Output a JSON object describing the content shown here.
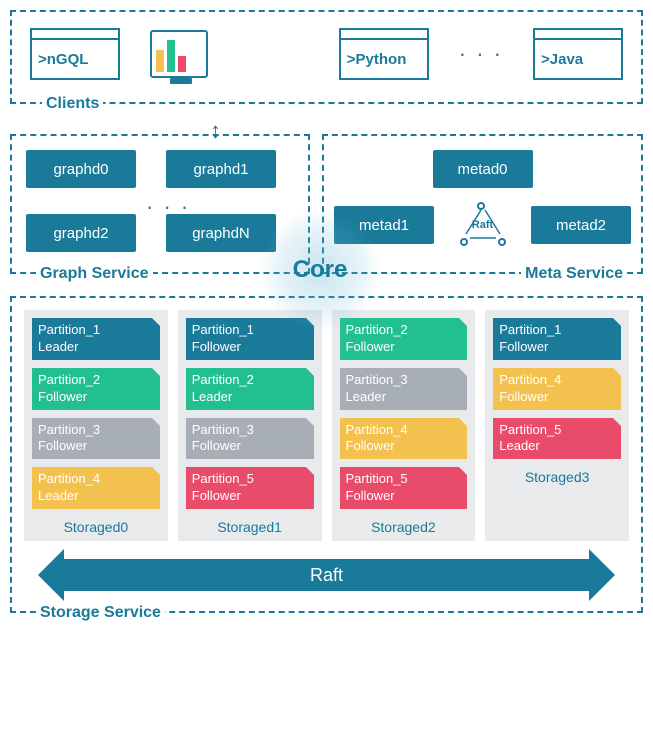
{
  "clients": {
    "label": "Clients",
    "items": [
      ">nGQL",
      ">Python",
      ">Java"
    ],
    "dots": "· · ·"
  },
  "graph_service": {
    "label": "Graph Service",
    "nodes": [
      "graphd0",
      "graphd1",
      "graphd2",
      "graphdN"
    ],
    "dots": "· · ·"
  },
  "meta_service": {
    "label": "Meta Service",
    "nodes": [
      "metad0",
      "metad1",
      "metad2"
    ],
    "raft_label": "Raft"
  },
  "core_label": "Core",
  "storage_service": {
    "label": "Storage Service",
    "raft_label": "Raft",
    "columns": [
      {
        "name": "Storaged0",
        "partitions": [
          {
            "title": "Partition_1",
            "role": "Leader",
            "color": "c-blue"
          },
          {
            "title": "Partition_2",
            "role": "Follower",
            "color": "c-green"
          },
          {
            "title": "Partition_3",
            "role": "Follower",
            "color": "c-gray"
          },
          {
            "title": "Partition_4",
            "role": "Leader",
            "color": "c-yellow"
          }
        ]
      },
      {
        "name": "Storaged1",
        "partitions": [
          {
            "title": "Partition_1",
            "role": "Follower",
            "color": "c-blue"
          },
          {
            "title": "Partition_2",
            "role": "Leader",
            "color": "c-green"
          },
          {
            "title": "Partition_3",
            "role": "Follower",
            "color": "c-gray"
          },
          {
            "title": "Partition_5",
            "role": "Follower",
            "color": "c-pink"
          }
        ]
      },
      {
        "name": "Storaged2",
        "partitions": [
          {
            "title": "Partition_2",
            "role": "Follower",
            "color": "c-green"
          },
          {
            "title": "Partition_3",
            "role": "Leader",
            "color": "c-gray"
          },
          {
            "title": "Partition_4",
            "role": "Follower",
            "color": "c-yellow"
          },
          {
            "title": "Partition_5",
            "role": "Follower",
            "color": "c-pink"
          }
        ]
      },
      {
        "name": "Storaged3",
        "partitions": [
          {
            "title": "Partition_1",
            "role": "Follower",
            "color": "c-blue"
          },
          {
            "title": "Partition_4",
            "role": "Follower",
            "color": "c-yellow"
          },
          {
            "title": "Partition_5",
            "role": "Leader",
            "color": "c-pink"
          }
        ]
      }
    ]
  }
}
